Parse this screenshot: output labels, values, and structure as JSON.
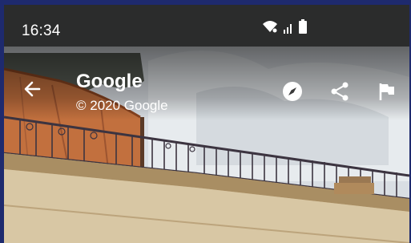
{
  "status_bar": {
    "time": "16:34",
    "icons": [
      "wifi-icon",
      "signal-icon",
      "battery-icon"
    ]
  },
  "header": {
    "title": "Google",
    "subtitle": "© 2020 Google",
    "actions": [
      "back-arrow-icon",
      "compass-icon",
      "share-icon",
      "flag-icon"
    ]
  },
  "colors": {
    "status_bar_bg": "#1c1c1c",
    "text": "#ffffff",
    "frame_border": "#1e2a6e"
  }
}
